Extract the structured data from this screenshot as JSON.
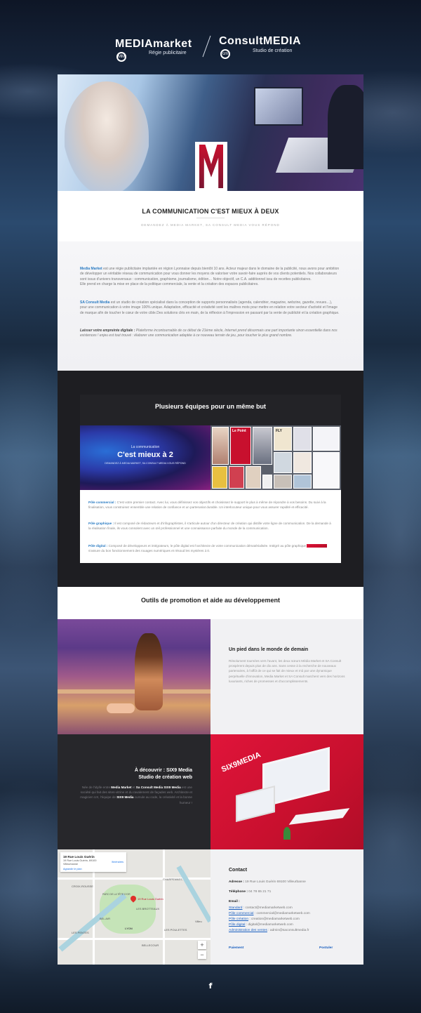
{
  "header": {
    "logo1_name": "MEDIAmarket",
    "logo1_ring": "MM",
    "logo1_tag": "Régie publicitaire",
    "logo2_name": "ConsultMEDIA",
    "logo2_ring": "cm",
    "logo2_tag": "Studio de création"
  },
  "intro": {
    "title": "LA COMMUNICATION C'EST MIEUX À DEUX",
    "subtitle": "DEMANDEZ À MEDIA MARKET, SA CONSULT MEDIA VOUS RÉPOND",
    "p1_brand": "Media Market",
    "p1_text": " est une régie publicitaire implantée en région Lyonnaise depuis bientôt 10 ans. Acteur majeur dans le domaine de la publicité, nous avons pour ambition de développer un véritable réseau de communication pour vous donner les moyens de valoriser votre savoir-faire auprès de vos clients potentiels. Nos collaborateurs sont issus d'univers transversaux : communication, graphisme, journalisme, édition… Notre objectif, un C.A. additionnel issu de recettes publicitaires.",
    "p1_text2": "Elle prend en charge la mise en place de la politique commerciale, la vente et la création des espaces publicitaires.",
    "p2_brand": "SA Consult Media",
    "p2_text": " est un studio de création spécialisé dans la conception de supports personnalisés (agenda, calendrier, magazine, webzine, gazette, revues…), pour une communication à votre image 100% unique. Adaptation, efficacité et créativité sont les maîtres mots pour mettre en relation votre secteur d'activité et l'image de marque afin de toucher le cœur de votre cible.Des solutions clés en main, de la réflexion à l'impression en passant par la vente de publicité et la création graphique.",
    "p3_lead": "Laisser votre empreinte digitale :",
    "p3_text": " Plateforme incontournable de ce début de 21ème siècle, Internet prend désormais une part importante sinon essentielle dans nos existences ! enjeu est tout trouvé : élaborer une communication adaptée à ce nouveau terrain de jeu, pour toucher le plus grand nombre."
  },
  "teams": {
    "title": "Plusieurs équipes pour un même but",
    "banner_small": "La communication",
    "banner_big": "C'est mieux à 2",
    "banner_xs": "DEMANDEZ À MEDIA MARKET, SA CONSULT MEDIA VOUS RÉPOND",
    "mag_title": "Le Point",
    "mag_title2": "FLY",
    "pole1_name": "Pôle commercial :",
    "pole1_text": " C'est votre premier contact. Avec lui, vous définissez vos objectifs et choisissez le support le plus à même de répondre à vos besoins. Du suivi à la finalisation, vous construisez ensemble une relation de confiance et un partenariat durable. Un interlocuteur unique pour vous assurer rapidité et efficacité.",
    "pole2_name": "Pôle graphique :",
    "pole2_text": " Il est composé de rédacteurs et d'infographistes, il s'articule autour d'un directeur de création qui distille votre ligne de communication. De la demande à la réalisation finale, ils vous consolent avec un œil professionnel et une connaissance parfaite du monde de la communication.",
    "pole3_name": "Pôle digital :",
    "pole3_text_a": " Composé de développeurs et intégrateurs, le pôle digital est l'architecte de votre communication dématérialisée. Intégré au pôle graphique ",
    "pole3_highlight": "\"SIX9 Média\"",
    "pole3_text_b": " s'assure du bon fonctionnement des rouages numériques et résoud les mystères 2.0."
  },
  "promo": {
    "title": "Outils de promotion et aide au développement",
    "side_title": "Un pied dans le monde de demain",
    "side_text": "Résolument tournées vers l'avant, les deux sœurs Média Market et SA Consult prospèrent depuis plus de dix ans. Sans cesse à la recherche de nouveaux partenaires, à l'affût de ce qui se fait de mieux et mû par une dynamique perpétuelle d'innovation, Media Market et SA Consult marchent vers des horizons luxuriants, riches de promesses et d'accomplissements.",
    "six9_title1": "À découvrir : SIX9 Media",
    "six9_title2": "Studio de création web",
    "six9_a": "Née de l'idylle entre ",
    "six9_b1": "Media Market",
    "six9_c": " et ",
    "six9_b2": "Sa Consult Media",
    "six9_d": " ",
    "six9_b3": "SIX9 Media",
    "six9_e": " est une société qui fait des sites-vitrine et du ravalement de façades web. Architecte et magicien UX, l'équipe de ",
    "six9_b4": "SIX9 Media",
    "six9_f": " cumule au code, la créativité et la bonne humeur !",
    "red_logo": "SIX9MEDIA"
  },
  "map": {
    "place": "19 Rue Louis Guérin",
    "address": "19 Rue Louis Guérin, 69100 Villeurbanne",
    "directions": "Itinéraires",
    "enlarge": "Agrandir le plan",
    "pin_label": "19 Rue Louis Guérin",
    "labels": [
      "BEL AIR",
      "PARC DE LA TÊTE D'OR",
      "LES BROTTEAUX",
      "LYON",
      "CROIX-ROUSSE",
      "LES PENTES",
      "BELLECOUR",
      "Villeu",
      "LES POULETTES",
      "CHARPENNES"
    ],
    "zoom_in": "+",
    "zoom_out": "−"
  },
  "contact": {
    "title": "Contact",
    "address_label": "Adresse :",
    "address_value": " 19 Rue Louis Guérin 69100 Villeurbanne",
    "phone_label": "Téléphone :",
    "phone_value": " 04 78 65 21 71",
    "email_label": "Email :",
    "emails": [
      {
        "label": "Standard",
        "value": " : contact@mediamarketweb.com"
      },
      {
        "label": "Pôle commercial",
        "value": " : commercial@mediamarketweb.com"
      },
      {
        "label": "Pôle création",
        "value": " : creation@mediamarketweb.com"
      },
      {
        "label": "Pôle digital",
        "value": " : digital@mediamarketweb.com"
      },
      {
        "label": "Administration des ventes",
        "value": " : admin@saconsultmedia.fr"
      }
    ],
    "pay": "Paiement",
    "post": "Postuler"
  },
  "footer": {
    "facebook": "f"
  }
}
